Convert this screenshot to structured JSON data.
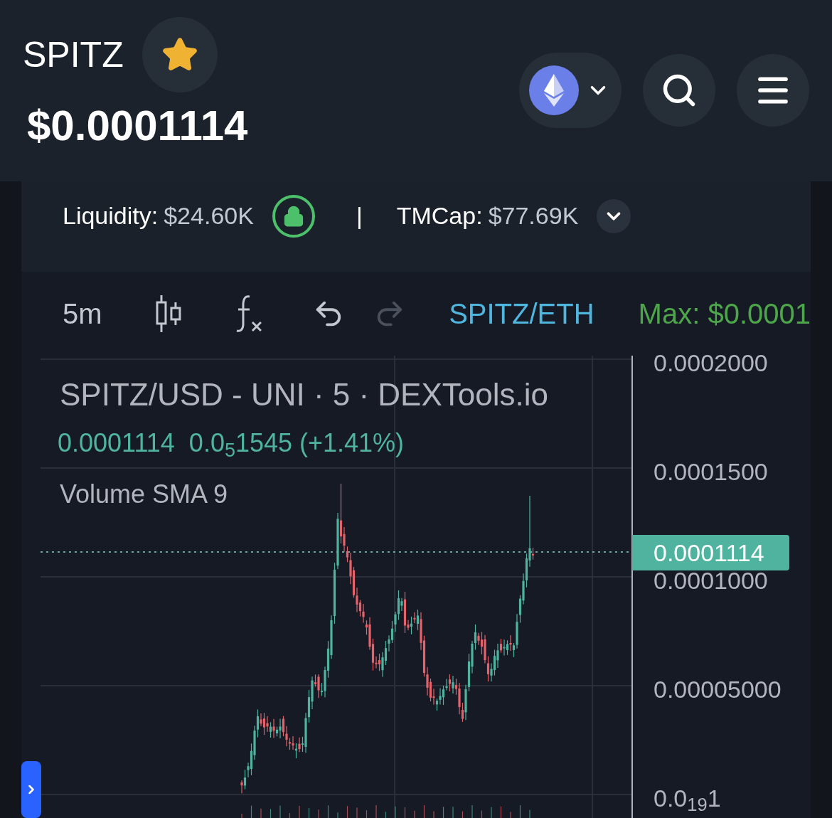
{
  "header": {
    "token": "SPITZ",
    "favorite": true,
    "price": "$0.0001114"
  },
  "stats": {
    "liquidity_label": "Liquidity:",
    "liquidity_value": "$24.60K",
    "locked": true,
    "separator": "|",
    "tmcap_label": "TMCap:",
    "tmcap_value": "$77.69K"
  },
  "toolbar": {
    "interval": "5m",
    "undo": {
      "disabled": false
    },
    "redo": {
      "disabled": true
    },
    "pair": "SPITZ/ETH",
    "max_label": "Max:",
    "max_value": "$0.0001"
  },
  "chart": {
    "title": "SPITZ/USD - UNI · 5 · DEXTools.io",
    "last": "0.0001114",
    "change": "0.0$_{5}$1545 (+1.41%)",
    "indicator": "Volume SMA 9",
    "y_labels": [
      "0.0002000",
      "0.0001500",
      "0.0001000",
      "0.00005000",
      "0.0$_{19}$1"
    ],
    "current_price": "0.0001114"
  }
}
